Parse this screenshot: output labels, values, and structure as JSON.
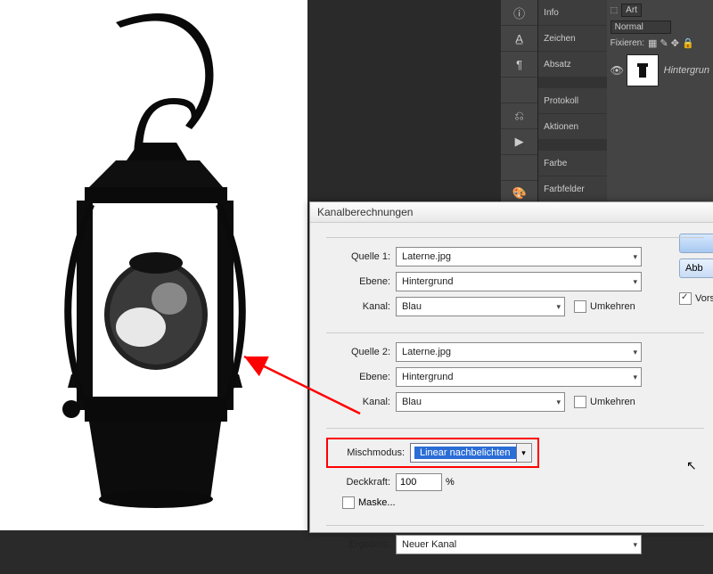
{
  "panels": {
    "items": [
      {
        "icon": "ⓘ",
        "label": "Info"
      },
      {
        "icon": "A̲",
        "label": "Zeichen"
      },
      {
        "icon": "¶",
        "label": "Absatz"
      },
      {
        "icon": "",
        "label": ""
      },
      {
        "icon": "⎌",
        "label": "Protokoll"
      },
      {
        "icon": "▶",
        "label": "Aktionen"
      },
      {
        "icon": "",
        "label": ""
      },
      {
        "icon": "🎨",
        "label": "Farbe"
      },
      {
        "icon": "▦",
        "label": "Farbfelder"
      }
    ]
  },
  "layers": {
    "kind": "Art",
    "mode": "Normal",
    "lock_label": "Fixieren:",
    "layer_name": "Hintergrun"
  },
  "dialog": {
    "title": "Kanalberechnungen",
    "source1": {
      "title": "Quelle 1:",
      "file": "Laterne.jpg",
      "layer_label": "Ebene:",
      "layer": "Hintergrund",
      "channel_label": "Kanal:",
      "channel": "Blau",
      "invert": "Umkehren"
    },
    "source2": {
      "title": "Quelle 2:",
      "file": "Laterne.jpg",
      "layer_label": "Ebene:",
      "layer": "Hintergrund",
      "channel_label": "Kanal:",
      "channel": "Blau",
      "invert": "Umkehren"
    },
    "blend": {
      "label": "Mischmodus:",
      "value": "Linear nachbelichten"
    },
    "opacity": {
      "label": "Deckkraft:",
      "value": "100",
      "pct": "%"
    },
    "mask": "Maske...",
    "result": {
      "label": "Ergebnis:",
      "value": "Neuer Kanal"
    },
    "buttons": {
      "ok": "",
      "cancel": "Abb",
      "preview": "Vors"
    }
  }
}
